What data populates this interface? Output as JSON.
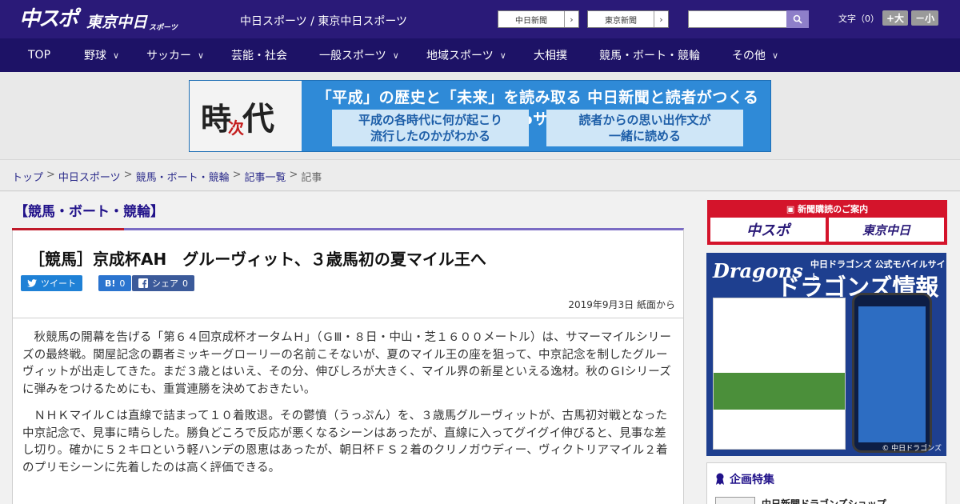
{
  "header": {
    "logo_main": "中スポ",
    "logo_sub": "東京中日",
    "logo_sub_small": "スポーツ",
    "site_title": "中日スポーツ / 東京中日スポーツ",
    "chunichi_button": "中日新聞",
    "tokyo_button": "東京新聞",
    "search_placeholder": "",
    "font_size_label": "文字（0）",
    "font_larger": "+大",
    "font_smaller": "－小"
  },
  "nav": {
    "items": [
      {
        "label": "TOP",
        "has_menu": false
      },
      {
        "label": "野球",
        "has_menu": true
      },
      {
        "label": "サッカー",
        "has_menu": true
      },
      {
        "label": "芸能・社会",
        "has_menu": false
      },
      {
        "label": "一般スポーツ",
        "has_menu": true
      },
      {
        "label": "地域スポーツ",
        "has_menu": true
      },
      {
        "label": "大相撲",
        "has_menu": false
      },
      {
        "label": "競馬・ボート・競輪",
        "has_menu": false
      },
      {
        "label": "その他",
        "has_menu": true
      }
    ]
  },
  "banner": {
    "logo_ji": "時",
    "logo_tsugi": "次",
    "logo_dai": "代",
    "headline": "「平成」の歴史と「未来」を読み取る 中日新聞と読者がつくるWebサイト",
    "box1_line1": "平成の各時代に何が起こり",
    "box1_line2": "流行したのかがわかる",
    "box2_line1": "読者からの思い出作文が",
    "box2_line2": "一緒に読める"
  },
  "breadcrumb": {
    "items": [
      "トップ",
      "中日スポーツ",
      "競馬・ボート・競輪",
      "記事一覧"
    ],
    "current": "記事",
    "separator": ">"
  },
  "article": {
    "category": "【競馬・ボート・競輪】",
    "title": "［競馬］京成杯AH　グルーヴィット、３歳馬初の夏マイル王へ",
    "share_tweet": "ツイート",
    "share_hatena_icon": "B!",
    "share_hatena_count": "0",
    "share_facebook": "シェア",
    "share_facebook_count": "0",
    "date": "2019年9月3日 紙面から",
    "paragraphs": [
      "秋競馬の開幕を告げる「第６４回京成杯オータムＨ」（ＧⅢ・８日・中山・芝１６００メートル）は、サマーマイルシリーズの最終戦。関屋記念の覇者ミッキーグローリーの名前こそないが、夏のマイル王の座を狙って、中京記念を制したグルーヴィットが出走してきた。まだ３歳とはいえ、その分、伸びしろが大きく、マイル界の新星といえる逸材。秋のＧⅠシリーズに弾みをつけるためにも、重賞連勝を決めておきたい。",
      "ＮＨＫマイルＣは直線で詰まって１０着敗退。その鬱憤（うっぷん）を、３歳馬グルーヴィットが、古馬初対戦となった中京記念で、見事に晴らした。勝負どころで反応が悪くなるシーンはあったが、直線に入ってグイグイ伸びると、見事な差し切り。確かに５２キロという軽ハンデの恩恵はあったが、朝日杯ＦＳ２着のクリノガウディー、ヴィクトリアマイル２着のプリモシーンに先着したのは高く評価できる。"
    ]
  },
  "sidebar": {
    "subscribe_header": "新聞購読のご案内",
    "subscribe_chuspo": "中スポ",
    "subscribe_tokyo": "東京中日",
    "dragons_logo": "Dragons",
    "dragons_subtitle": "中日ドラゴンズ 公式モバイルサイト",
    "dragons_title": "ドラゴンズ情報",
    "dragons_copyright": "© 中日ドラゴンズ",
    "feature_heading": "企画特集",
    "feature_item": "中日新聞ドラゴンズショップ"
  },
  "colors": {
    "header_bg": "#2a1a78",
    "nav_bg": "#1d1266",
    "accent_red": "#c01a2a",
    "accent_purple": "#7b6cc4",
    "twitter_blue": "#1f81d6",
    "facebook_blue": "#3b5a9a"
  }
}
